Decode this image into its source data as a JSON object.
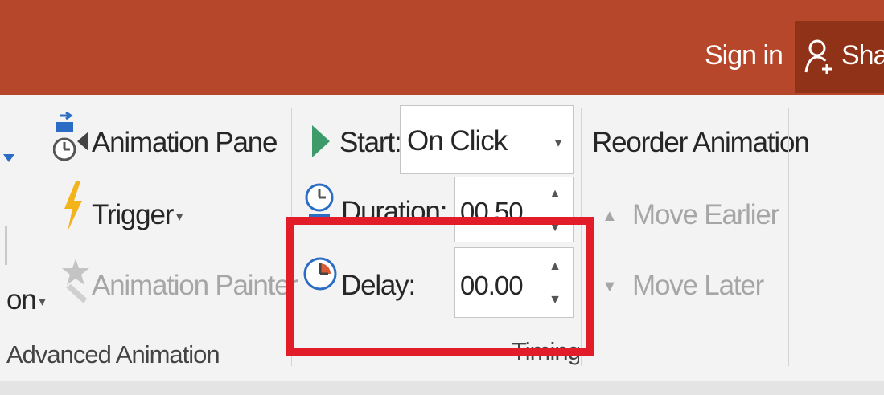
{
  "titlebar": {
    "sign_in": "Sign in",
    "share": "Share"
  },
  "advanced_animation": {
    "add_animation_fragment": "on",
    "animation_pane": "Animation Pane",
    "trigger": "Trigger",
    "animation_painter": "Animation Painter",
    "group_label": "Advanced Animation"
  },
  "timing": {
    "start_label": "Start:",
    "start_value": "On Click",
    "duration_label": "Duration:",
    "duration_value": "00.50",
    "delay_label": "Delay:",
    "delay_value": "00.00",
    "group_label": "Timing"
  },
  "reorder": {
    "title": "Reorder Animation",
    "move_earlier": "Move Earlier",
    "move_later": "Move Later"
  },
  "icons": {
    "spin_up": "▲",
    "spin_down": "▼",
    "dropdown": "▾",
    "earlier": "▲",
    "later": "▼"
  },
  "colors": {
    "title_bar": "#b7472a",
    "share_bg": "#8f3218",
    "highlight": "#e31c2a"
  }
}
